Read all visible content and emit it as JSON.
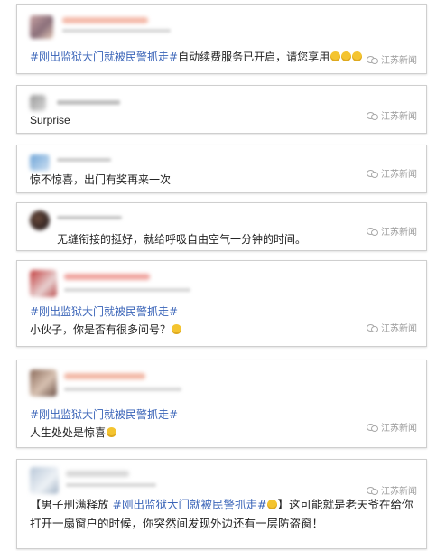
{
  "posts": [
    {
      "hashtag": "#刚出监狱大门就被民警抓走#",
      "text": "自动续费服务已开启，请您享用",
      "emoji_count": 3,
      "watermark": "江苏新闻"
    },
    {
      "text": "Surprise",
      "watermark": "江苏新闻"
    },
    {
      "text": "惊不惊喜，出门有奖再来一次",
      "watermark": "江苏新闻"
    },
    {
      "text": "无缝衔接的挺好，就给呼吸自由空气一分钟的时间。",
      "watermark": "江苏新闻"
    },
    {
      "hashtag": "#刚出监狱大门就被民警抓走#",
      "text": "小伙子，你是否有很多问号？",
      "watermark": "江苏新闻"
    },
    {
      "hashtag": "#刚出监狱大门就被民警抓走#",
      "text": "人生处处是惊喜",
      "watermark": "江苏新闻"
    },
    {
      "line1_prefix": "【男子刑满释放 ",
      "hashtag": "#刚出监狱大门就被民警抓走#",
      "line1_suffix": "】这可能就是老天爷在给你",
      "line2": "打开一扇窗户的时候，你突然间发现外边还有一层防盗窗！",
      "watermark": "江苏新闻"
    }
  ],
  "colors": {
    "hashtag": "#3a64b8",
    "watermark": "#9a9a9a",
    "card_border": "#cfcfcf"
  },
  "icons": {
    "watermark": "weibo-logo-icon",
    "emoji": "emoji-icon",
    "avatar": "blurred-avatar"
  }
}
